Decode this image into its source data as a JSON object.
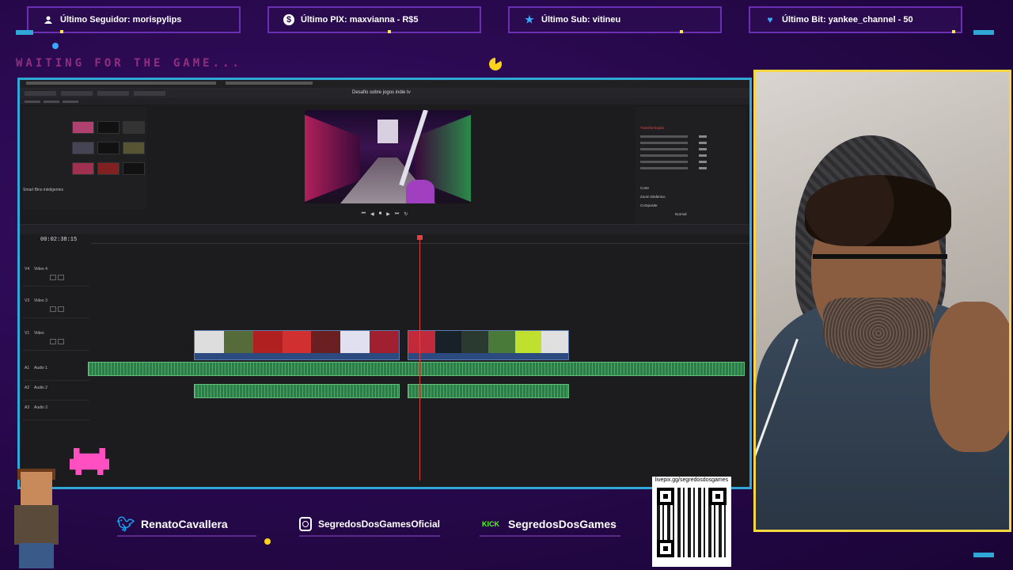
{
  "alerts": [
    {
      "icon": "user-icon",
      "label": "Último Seguidor: morispylips"
    },
    {
      "icon": "dollar-icon",
      "label": "Último PIX: maxvianna - R$5"
    },
    {
      "icon": "star-icon",
      "label": "Último Sub: vitineu"
    },
    {
      "icon": "heart-gem-icon",
      "label": "Último Bit: yankee_channel - 50"
    }
  ],
  "waiting_text": "WAITING FOR THE GAME...",
  "editor": {
    "project_title": "Desafio sobre jogos indie tv",
    "smart_bins": "Smart Bins inteligentes",
    "timecode": "00:02:38:15",
    "tracks": [
      {
        "id": "V4",
        "name": "Video 4"
      },
      {
        "id": "V3",
        "name": "Video 3"
      },
      {
        "id": "V1",
        "name": "Video"
      },
      {
        "id": "A1",
        "name": "Audio 1"
      },
      {
        "id": "A2",
        "name": "Audio 2"
      },
      {
        "id": "A3",
        "name": "Audio 3"
      }
    ],
    "inspector_sections": [
      "Transformação",
      "Corte",
      "Zoom Dinâmico",
      "Composite"
    ],
    "composite_mode": "Normal"
  },
  "socials": [
    {
      "icon": "twitter-icon",
      "label": "RenatoCavallera",
      "color": "#1da1f2"
    },
    {
      "icon": "instagram-icon",
      "label": "SegredosDosGamesOficial",
      "color": "#c13584"
    },
    {
      "icon": "kick-icon",
      "label": "SegredosDosGames",
      "color": "#53fc18",
      "icon_text": "KICK"
    }
  ],
  "qr": {
    "caption": "livepix.gg/segredosdosgames"
  },
  "colors": {
    "frame_blue": "#2fa8d8",
    "cam_border": "#f5d742",
    "accent_purple": "#6b2fb3"
  }
}
